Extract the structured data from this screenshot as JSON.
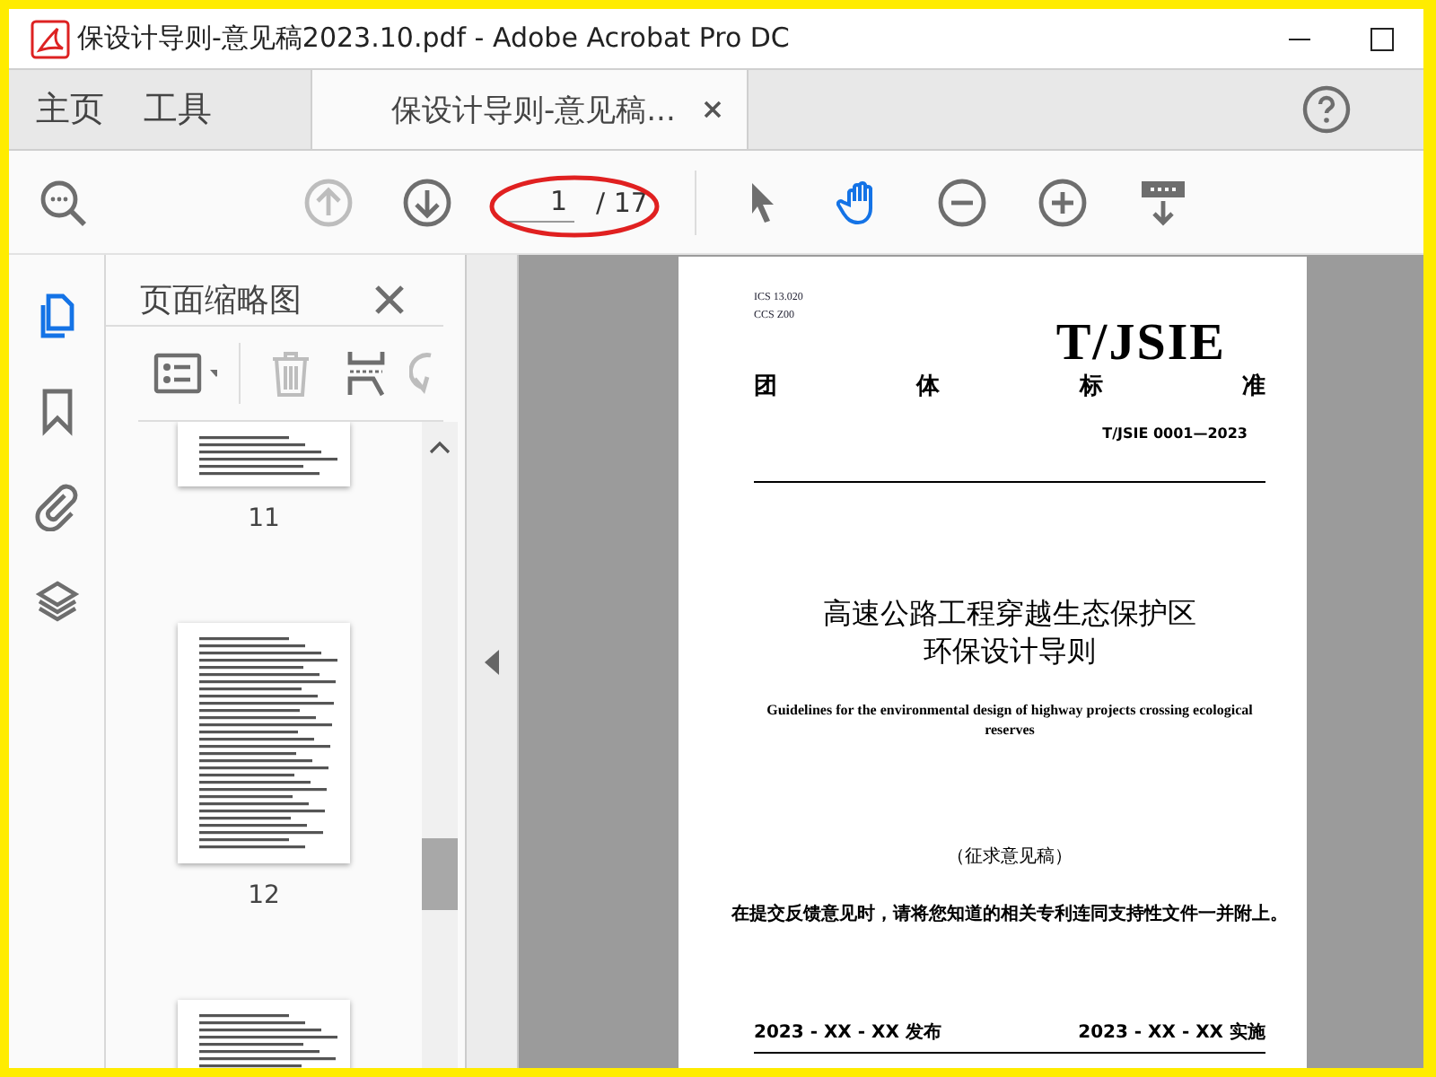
{
  "window": {
    "title": "保设计导则-意见稿2023.10.pdf - Adobe Acrobat Pro DC"
  },
  "tabs": [
    {
      "label": "主页",
      "selected": false,
      "closable": false
    },
    {
      "label": "工具",
      "selected": false,
      "closable": false
    },
    {
      "label": "保设计导则-意见稿...",
      "selected": true,
      "closable": true
    }
  ],
  "toolbar": {
    "page_number": "1",
    "page_total": "/ 17",
    "highlighted": true,
    "nav": [
      {
        "kind": "prev-page",
        "disabled": true
      },
      {
        "kind": "next-page",
        "disabled": false
      }
    ],
    "tools": [
      {
        "kind": "select",
        "selected": false
      },
      {
        "kind": "hand",
        "selected": true
      },
      {
        "kind": "zoom-out",
        "selected": false
      },
      {
        "kind": "zoom-in",
        "selected": false
      },
      {
        "kind": "scroll-mode",
        "selected": false
      }
    ]
  },
  "rail": [
    {
      "kind": "pages",
      "selected": true
    },
    {
      "kind": "bookmarks",
      "selected": false
    },
    {
      "kind": "attachments",
      "selected": false
    },
    {
      "kind": "layers",
      "selected": false
    }
  ],
  "panel": {
    "title": "页面缩略图",
    "thumbnails": [
      {
        "label": "11",
        "kind": "cuttop"
      },
      {
        "label": "12",
        "kind": "whole"
      },
      {
        "kind": "cutbottom"
      }
    ]
  },
  "document": {
    "ics": "ICS  13.020",
    "ccs": "CCS  Z00",
    "mark": "T/JSIE",
    "category": [
      "团",
      "体",
      "标",
      "准"
    ],
    "number": "T/JSIE 0001—2023",
    "title": [
      "高速公路工程穿越生态保护区",
      "环保设计导则"
    ],
    "english": "Guidelines for the environmental design of highway projects crossing ecological reserves",
    "draft": "（征求意见稿）",
    "notice": "在提交反馈意见时，请将您知道的相关专利连同支持性文件一并附上。",
    "published": "2023 - XX - XX 发布",
    "effective": "2023 - XX - XX 实施"
  }
}
